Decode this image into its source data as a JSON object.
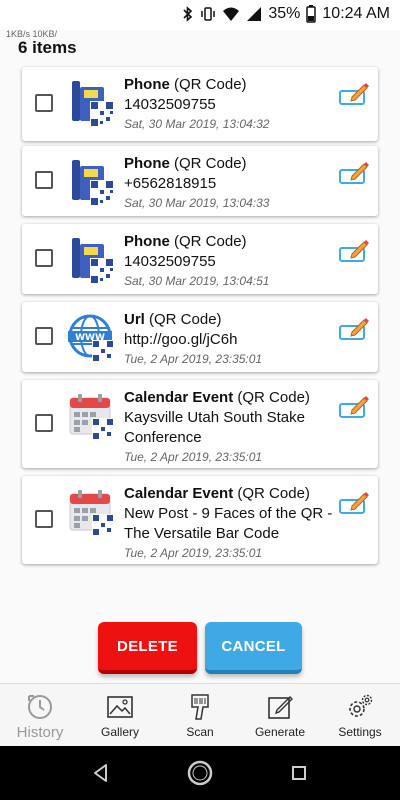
{
  "status_bar": {
    "net_speed": "1KB/s  10KB/",
    "battery": "35%",
    "time": "10:24 AM"
  },
  "list": {
    "count_label": "6 items",
    "items": [
      {
        "type_name": "Phone",
        "format": "(QR Code)",
        "value": "14032509755",
        "date": "Sat, 30 Mar 2019, 13:04:32",
        "icon": "phone-qr-icon"
      },
      {
        "type_name": "Phone",
        "format": "(QR Code)",
        "value": "+6562818915",
        "date": "Sat, 30 Mar 2019, 13:04:33",
        "icon": "phone-qr-icon"
      },
      {
        "type_name": "Phone",
        "format": "(QR Code)",
        "value": "14032509755",
        "date": "Sat, 30 Mar 2019, 13:04:51",
        "icon": "phone-qr-icon"
      },
      {
        "type_name": "Url",
        "format": "(QR Code)",
        "value": "http://goo.gl/jC6h",
        "date": "Tue, 2 Apr 2019, 23:35:01",
        "icon": "url-qr-icon"
      },
      {
        "type_name": "Calendar Event",
        "format": "(QR Code)",
        "value": "Kaysville Utah South Stake Conference",
        "date": "Tue, 2 Apr 2019, 23:35:01",
        "icon": "calendar-qr-icon"
      },
      {
        "type_name": "Calendar Event",
        "format": "(QR Code)",
        "value": "New Post - 9 Faces of the QR - The Versatile Bar Code",
        "date": "Tue, 2 Apr 2019, 23:35:01",
        "icon": "calendar-qr-icon"
      }
    ]
  },
  "actions": {
    "delete_label": "DELETE",
    "cancel_label": "CANCEL",
    "delete_color": "#ee1111",
    "cancel_color": "#3ea9e4"
  },
  "nav": {
    "history": "History",
    "gallery": "Gallery",
    "scan": "Scan",
    "generate": "Generate",
    "settings": "Settings",
    "active": "history"
  }
}
